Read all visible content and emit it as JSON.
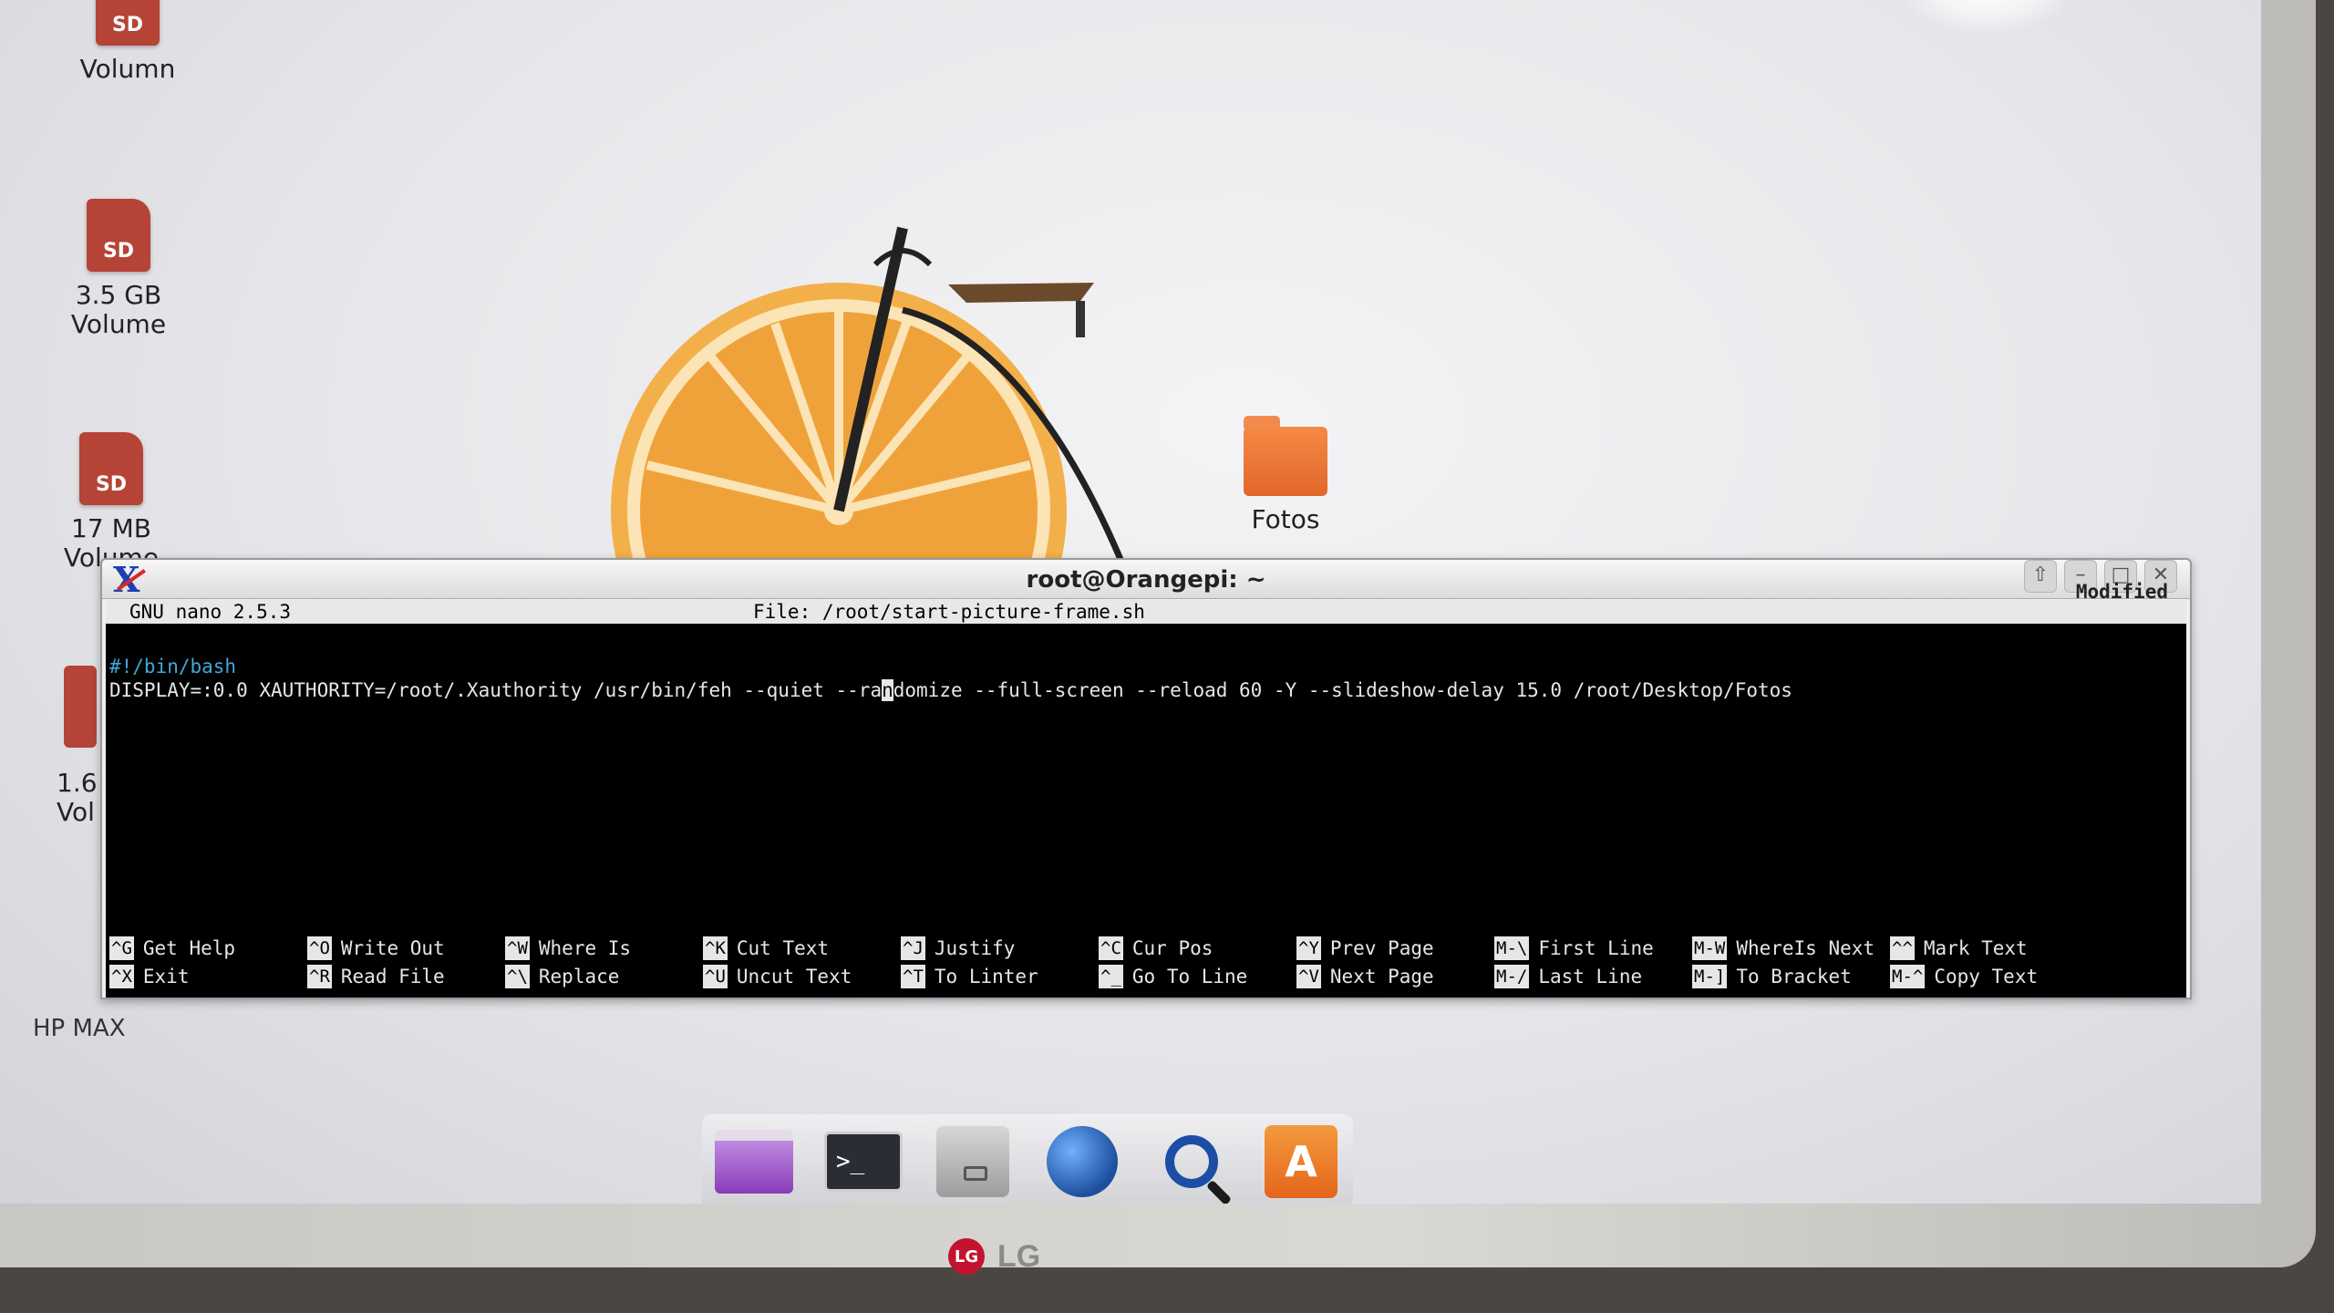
{
  "desktop": {
    "icons": [
      {
        "label": "Volumn"
      },
      {
        "label": "3.5 GB\nVolume"
      },
      {
        "label": "17 MB\nVolume"
      },
      {
        "label": "Fotos"
      }
    ],
    "partial_label": "1.6\nVol",
    "hp_label": "HP MAX"
  },
  "window": {
    "title": "root@Orangepi: ~",
    "controls": [
      "shade",
      "minimize",
      "maximize",
      "close"
    ]
  },
  "nano": {
    "version": "GNU nano 2.5.3",
    "file": "File: /root/start-picture-frame.sh",
    "status": "Modified",
    "lines": [
      "#!/bin/bash",
      "DISPLAY=:0.0 XAUTHORITY=/root/.Xauthority /usr/bin/feh --quiet --ra",
      "n",
      "domize --full-screen --reload 60 -Y --slideshow-delay 15.0 /root/Desktop/Fotos"
    ],
    "shortcuts": [
      {
        "key": "^G",
        "label": "Get Help"
      },
      {
        "key": "^O",
        "label": "Write Out"
      },
      {
        "key": "^W",
        "label": "Where Is"
      },
      {
        "key": "^K",
        "label": "Cut Text"
      },
      {
        "key": "^J",
        "label": "Justify"
      },
      {
        "key": "^C",
        "label": "Cur Pos"
      },
      {
        "key": "^Y",
        "label": "Prev Page"
      },
      {
        "key": "M-\\",
        "label": "First Line"
      },
      {
        "key": "M-W",
        "label": "WhereIs Next"
      },
      {
        "key": "^^",
        "label": "Mark Text"
      },
      {
        "key": "^X",
        "label": "Exit"
      },
      {
        "key": "^R",
        "label": "Read File"
      },
      {
        "key": "^\\",
        "label": "Replace"
      },
      {
        "key": "^U",
        "label": "Uncut Text"
      },
      {
        "key": "^T",
        "label": "To Linter"
      },
      {
        "key": "^_",
        "label": "Go To Line"
      },
      {
        "key": "^V",
        "label": "Next Page"
      },
      {
        "key": "M-/",
        "label": "Last Line"
      },
      {
        "key": "M-]",
        "label": "To Bracket"
      },
      {
        "key": "M-^",
        "label": "Copy Text"
      }
    ]
  },
  "dock": {
    "items": [
      "files-icon",
      "terminal-icon",
      "file-cabinet-icon",
      "web-browser-icon",
      "search-icon",
      "app-store-icon"
    ],
    "terminal_glyph": ">_",
    "store_glyph": "A"
  },
  "monitor": {
    "brand": "LG",
    "brand_mark": "LG"
  },
  "colors": {
    "accent_orange": "#f0a23a",
    "sd_red": "#b54437",
    "terminal_bg": "#000000",
    "shebang_color": "#3fa9d8"
  }
}
